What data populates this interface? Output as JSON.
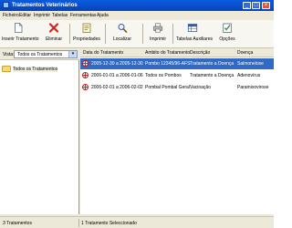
{
  "window": {
    "title": "Tratamentos Veterinários",
    "controls": [
      "_",
      "□",
      "×"
    ]
  },
  "menu": [
    "Ficheiro",
    "Editar",
    "Imprimir",
    "Tabelas",
    "Ferramentas",
    "Ajuda"
  ],
  "toolbar": [
    {
      "label": "Inserir Tratamento",
      "icon": "new-document-icon"
    },
    {
      "label": "Eliminar",
      "icon": "delete-icon"
    },
    {
      "label": "Propriedades",
      "icon": "properties-icon"
    },
    {
      "label": "Localizar",
      "icon": "search-icon"
    },
    {
      "label": "Imprimir",
      "icon": "printer-icon"
    },
    {
      "label": "Tabelas Auxiliares",
      "icon": "table-icon"
    },
    {
      "label": "Opções",
      "icon": "options-checklist-icon"
    }
  ],
  "sidebar": {
    "view_label": "Vista:",
    "view_value": "Todos os Tratamentos",
    "tree": [
      {
        "label": "Todos os Tratamentos",
        "icon": "folder-icon"
      }
    ]
  },
  "table": {
    "columns": [
      "Data do Tratamento",
      "Ambito do Tratamento",
      "Descrição",
      "Doença"
    ],
    "rows": [
      {
        "date": "2005-12-30 a 2005-12-30",
        "scope": "Pombo 12345/96-AFS",
        "description": "Tratamento a Doença",
        "disease": "Salmonelose",
        "selected": true
      },
      {
        "date": "2006-01-01 a 2006-01-06",
        "scope": "Todos os Pombos",
        "description": "Tratamento a Doença",
        "disease": "Adenovírus",
        "selected": false
      },
      {
        "date": "2006-02-01 a 2006-02-02",
        "scope": "Pombal Pombal Geral",
        "description": "Vacinação",
        "disease": "Paramixovirose",
        "selected": false
      }
    ]
  },
  "status": {
    "left": "3 Tratamentos",
    "right": "1 Tratamento Seleccionado"
  },
  "colors": {
    "titlebar": "#0A5BE0",
    "selection": "#316AC5",
    "chrome": "#ECE9D8"
  }
}
